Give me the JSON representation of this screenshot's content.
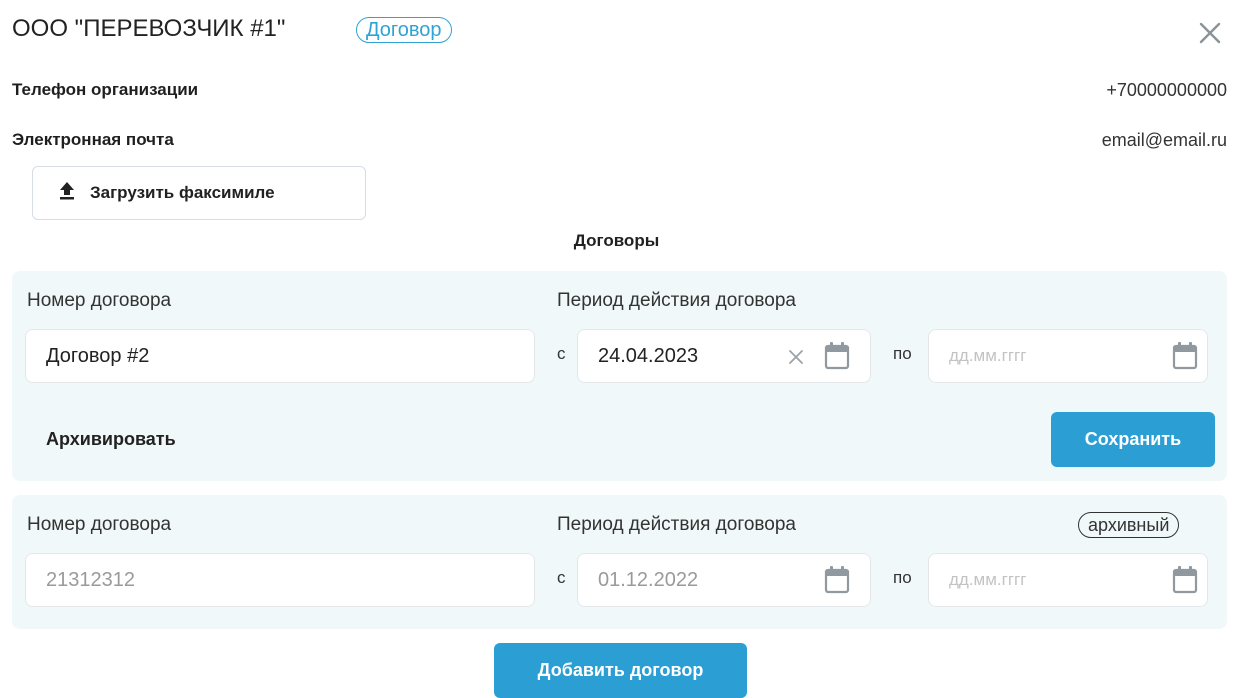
{
  "header": {
    "title": "ООО \"ПЕРЕВОЗЧИК #1\"",
    "type_badge": "Договор"
  },
  "info": {
    "phone_label": "Телефон организации",
    "phone_value": "+70000000000",
    "email_label": "Электронная почта",
    "email_value": "email@email.ru"
  },
  "upload": {
    "label": "Загрузить факсимиле",
    "icon": "upload-icon"
  },
  "contracts_title": "Договоры",
  "contracts": [
    {
      "number_label": "Номер договора",
      "number_value": "Договор #2",
      "period_label": "Период действия договора",
      "from_prefix": "с",
      "from_value": "24.04.2023",
      "to_prefix": "по",
      "to_placeholder": "дд.мм.гггг",
      "archive_label": "Архивировать",
      "save_label": "Сохранить"
    },
    {
      "number_label": "Номер договора",
      "number_value": "21312312",
      "period_label": "Период действия договора",
      "status_badge": "архивный",
      "from_prefix": "с",
      "from_value": "01.12.2022",
      "to_prefix": "по",
      "to_placeholder": "дд.мм.гггг"
    }
  ],
  "add_contract_label": "Добавить договор",
  "colors": {
    "accent": "#2b9fd3",
    "card_bg": "#f1f8f9",
    "muted_icon": "#9aa3a9"
  }
}
